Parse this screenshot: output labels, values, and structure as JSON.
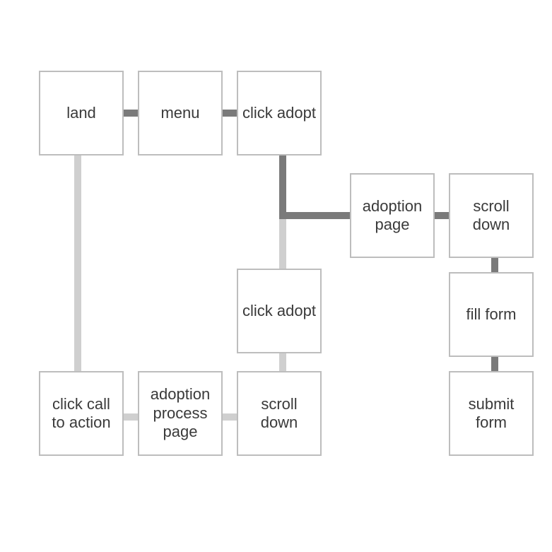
{
  "nodes": {
    "land": "land",
    "menu": "menu",
    "click_adopt_top": "click adopt",
    "adoption_page": "adoption page",
    "scroll_down_right": "scroll down",
    "fill_form": "fill form",
    "submit_form": "submit form",
    "click_adopt_mid": "click adopt",
    "scroll_down_mid": "scroll down",
    "adoption_process_page": "adoption process page",
    "click_cta": "click call to action"
  },
  "colors": {
    "border": "#bdbdbd",
    "edge_dark": "#7a7a7a",
    "edge_light": "#cfcfcf"
  }
}
